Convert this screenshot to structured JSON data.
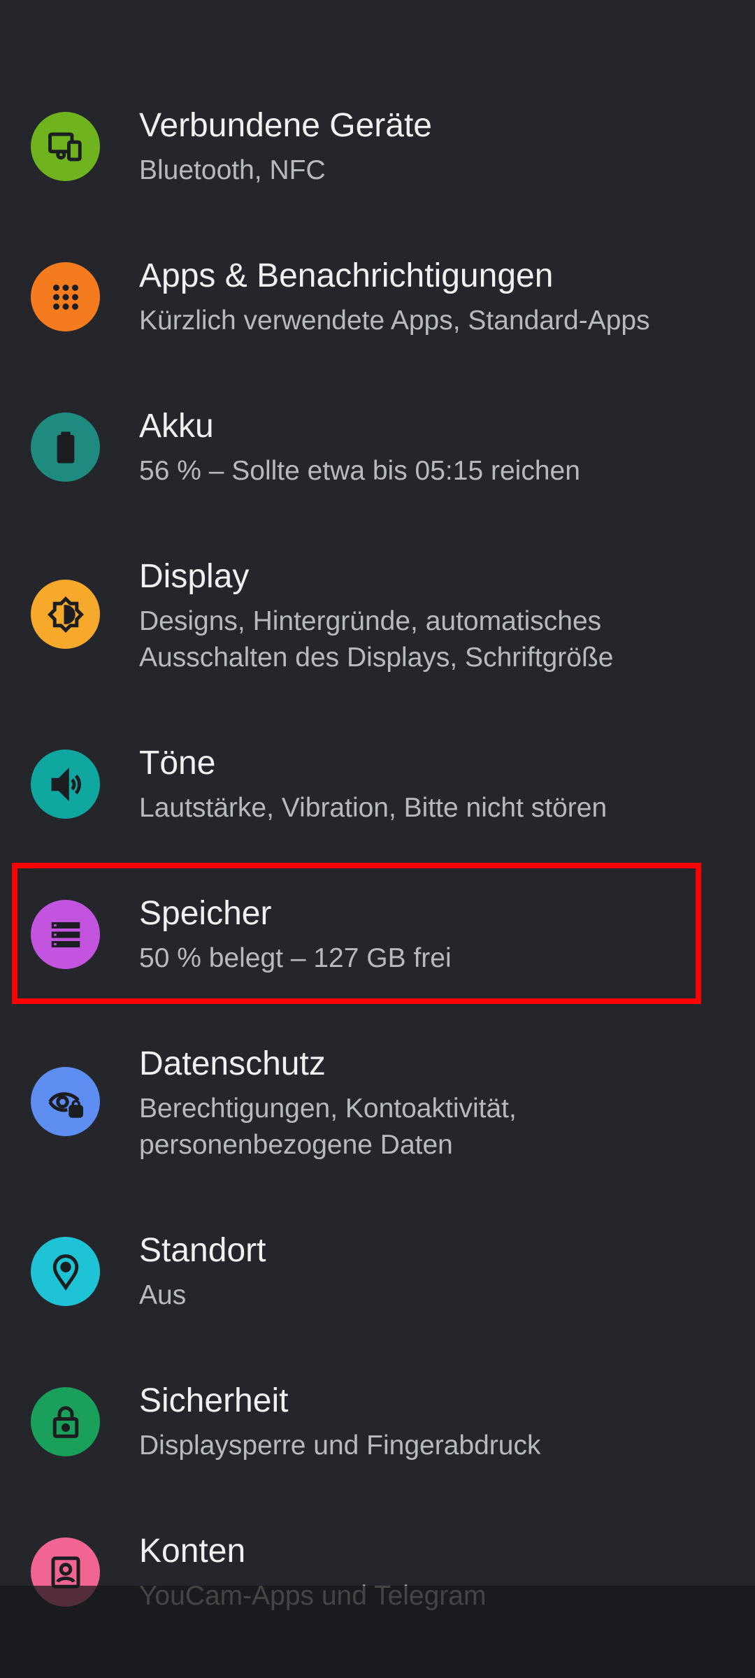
{
  "settings": {
    "items": [
      {
        "title": "Verbundene Geräte",
        "summary": "Bluetooth, NFC",
        "icon": "connected-devices-icon",
        "color": "#6fb31f"
      },
      {
        "title": "Apps & Benachrichtigungen",
        "summary": "Kürzlich verwendete Apps, Standard-Apps",
        "icon": "apps-grid-icon",
        "color": "#f47c1e"
      },
      {
        "title": "Akku",
        "summary": "56 % – Sollte etwa bis 05:15 reichen",
        "icon": "battery-icon",
        "color": "#1e8a80"
      },
      {
        "title": "Display",
        "summary_line1": "Designs, Hintergründe, automatisches",
        "summary_line2": "Ausschalten des Displays, Schriftgröße",
        "icon": "brightness-icon",
        "color": "#f7a92b"
      },
      {
        "title": "Töne",
        "summary": "Lautstärke, Vibration, Bitte nicht stören",
        "icon": "volume-icon",
        "color": "#10a7a0"
      },
      {
        "title": "Speicher",
        "summary": "50 % belegt – 127 GB frei",
        "icon": "storage-icon",
        "color": "#c354e0"
      },
      {
        "title": "Datenschutz",
        "summary_line1": "Berechtigungen, Kontoaktivität,",
        "summary_line2": "personenbezogene Daten",
        "icon": "privacy-eye-icon",
        "color": "#5e8ef2"
      },
      {
        "title": "Standort",
        "summary": "Aus",
        "icon": "location-pin-icon",
        "color": "#1ec3d6"
      },
      {
        "title": "Sicherheit",
        "summary": "Displaysperre und Fingerabdruck",
        "icon": "lock-icon",
        "color": "#1aa05b"
      },
      {
        "title": "Konten",
        "summary": "YouCam-Apps und Telegram",
        "icon": "account-icon",
        "color": "#f06591"
      }
    ]
  },
  "colors": {
    "background": "#24262b",
    "highlight": "#ff0000"
  }
}
